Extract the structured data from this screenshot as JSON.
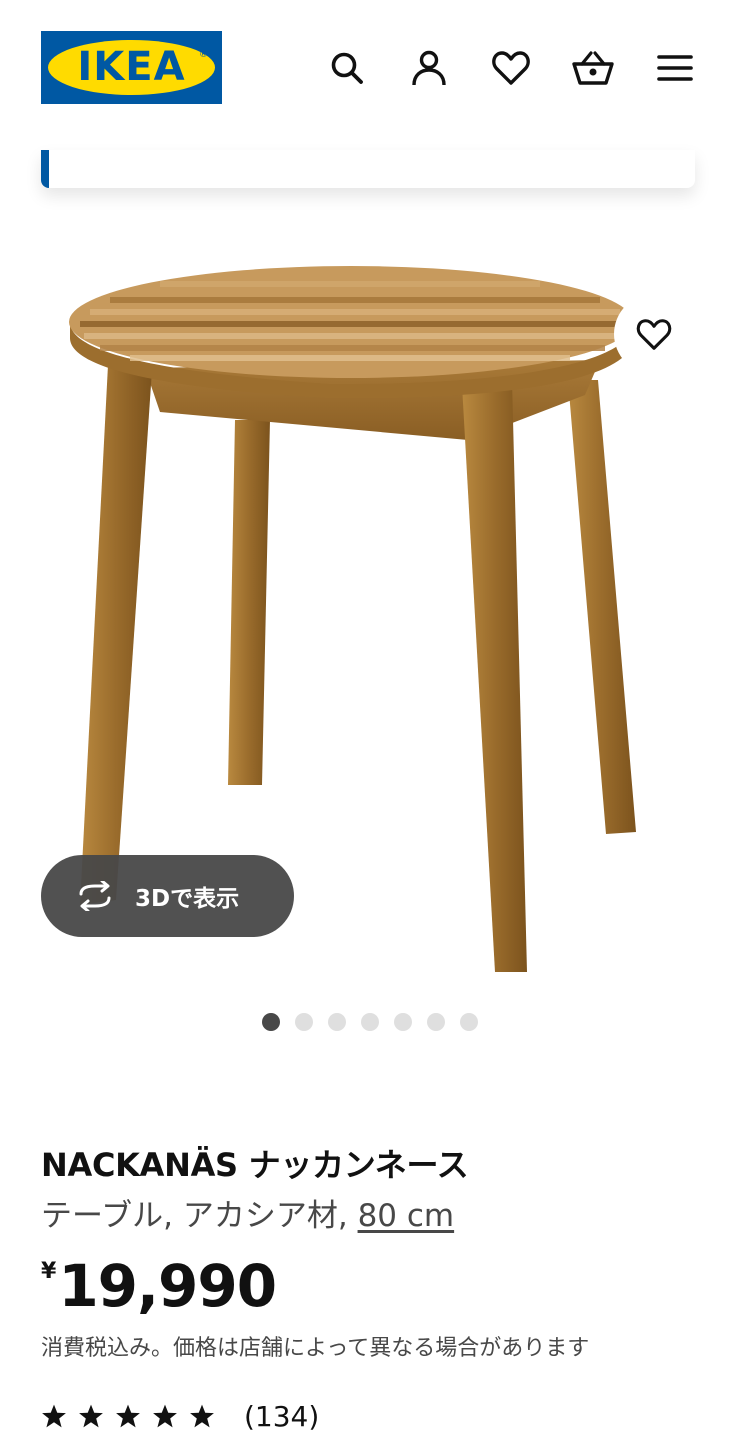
{
  "header": {
    "logo_text": "IKEA",
    "logo_mark": "®",
    "icons": [
      "search-icon",
      "user-icon",
      "heart-icon",
      "basket-icon",
      "menu-icon"
    ]
  },
  "colors": {
    "brand_blue": "#0058a3",
    "brand_yellow": "#ffdb00",
    "text": "#111111",
    "muted": "#484848"
  },
  "gallery": {
    "view_3d_label": "3Dで表示",
    "page_count": 7,
    "active_page": 1
  },
  "product": {
    "name": "NACKANÄS ナッカンネース",
    "description": "テーブル, アカシア材, ",
    "size": "80 cm",
    "currency": "¥",
    "price": "19,990",
    "tax_note": "消費税込み。価格は店舗によって異なる場合があります",
    "rating_stars": 5,
    "review_count": "(134)"
  }
}
